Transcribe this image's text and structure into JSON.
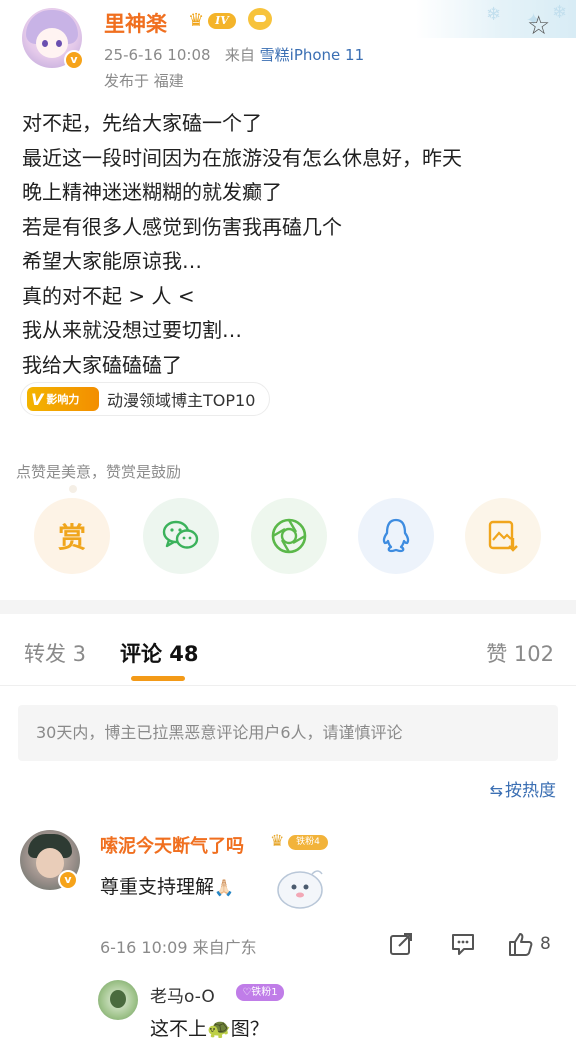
{
  "post": {
    "author": "里神楽",
    "level": "IV",
    "verified_mark": "v",
    "time": "25-6-16 10:08",
    "source_prefix": "来自",
    "source": "雪糕iPhone 11",
    "location": "发布于 福建",
    "lines": [
      "对不起，先给大家磕一个了",
      "最近这一段时间因为在旅游没有怎么休息好，昨天",
      "晚上精神迷迷糊糊的就发癫了",
      "若是有很多人感觉到伤害我再磕几个",
      "希望大家能原谅我…",
      "真的对不起 > 人 <",
      "我从来就没想过要切割…",
      "我给大家磕磕磕了"
    ],
    "influence_badge": "影响力",
    "influence_mark": "V",
    "topic": "动漫领域博主TOP10"
  },
  "reward_hint": "点赞是美意，赞赏是鼓励",
  "share": {
    "reward_label": "赏",
    "buttons": [
      "reward-icon",
      "wechat-icon",
      "moments-icon",
      "qq-icon",
      "save-image-icon"
    ]
  },
  "tabs": {
    "repost": "转发 3",
    "comment": "评论 48",
    "like": "赞 102"
  },
  "notice": "30天内，博主已拉黑恶意评论用户6人，请谨慎评论",
  "sort": "按热度",
  "comment": {
    "author": "嗦泥今天断气了吗",
    "badge": "铁粉4",
    "verified_mark": "v",
    "text": "尊重支持理解",
    "emoji": "🙏🏻",
    "time": "6-16 10:09 来自广东",
    "likes": "8"
  },
  "reply": {
    "author": "老马o-O",
    "badge": "♡铁粉1",
    "text_start": "这不上",
    "text_turtle": "🐢",
    "text_end": "图？"
  },
  "colors": {
    "accent": "#f39a18",
    "username": "#f06f1f",
    "link": "#3b6fb3",
    "muted": "#8a8a8a"
  }
}
